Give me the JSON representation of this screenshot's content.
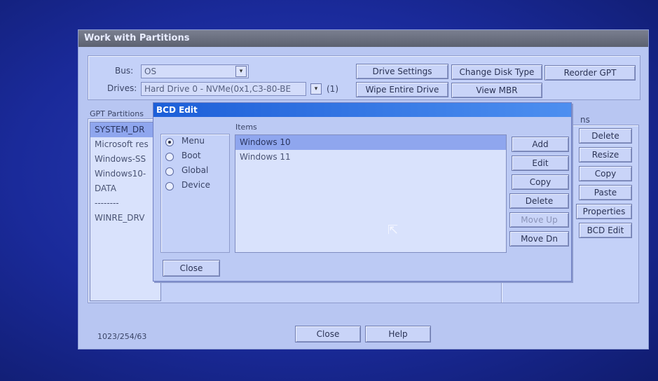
{
  "window": {
    "title": "Work with Partitions",
    "bus_label": "Bus:",
    "bus_value": "OS",
    "drives_label": "Drives:",
    "drives_value": "Hard Drive 0 - NVMe(0x1,C3-80-BE",
    "drives_count": "(1)",
    "top_buttons": [
      "Drive Settings",
      "Change Disk Type",
      "Reorder GPT",
      "Wipe Entire Drive",
      "View MBR"
    ],
    "partitions_label": "GPT Partitions",
    "partitions": [
      "SYSTEM_DR",
      "Microsoft res",
      "Windows-SS",
      "Windows10-",
      "DATA",
      "--------",
      "WINRE_DRV"
    ],
    "actions_label": "ns",
    "action_buttons": [
      "Delete",
      "Resize",
      "Copy",
      "Paste",
      "Properties",
      "BCD Edit"
    ],
    "status": "1023/254/63",
    "close_label": "Close",
    "help_label": "Help"
  },
  "bcd": {
    "title": "BCD Edit",
    "radios": [
      "Menu",
      "Boot",
      "Global",
      "Device"
    ],
    "selected_radio": "Menu",
    "items_label": "Items",
    "items": [
      "Windows 10",
      "Windows 11"
    ],
    "buttons": [
      "Add",
      "Edit",
      "Copy",
      "Delete",
      "Move Up",
      "Move Dn"
    ],
    "close_label": "Close"
  },
  "colors": {
    "desktop": "#1a2a9a",
    "window_bg": "#b8c6f2",
    "dialog_title": "#1d5fd8",
    "selection": "#8fa6ee"
  }
}
